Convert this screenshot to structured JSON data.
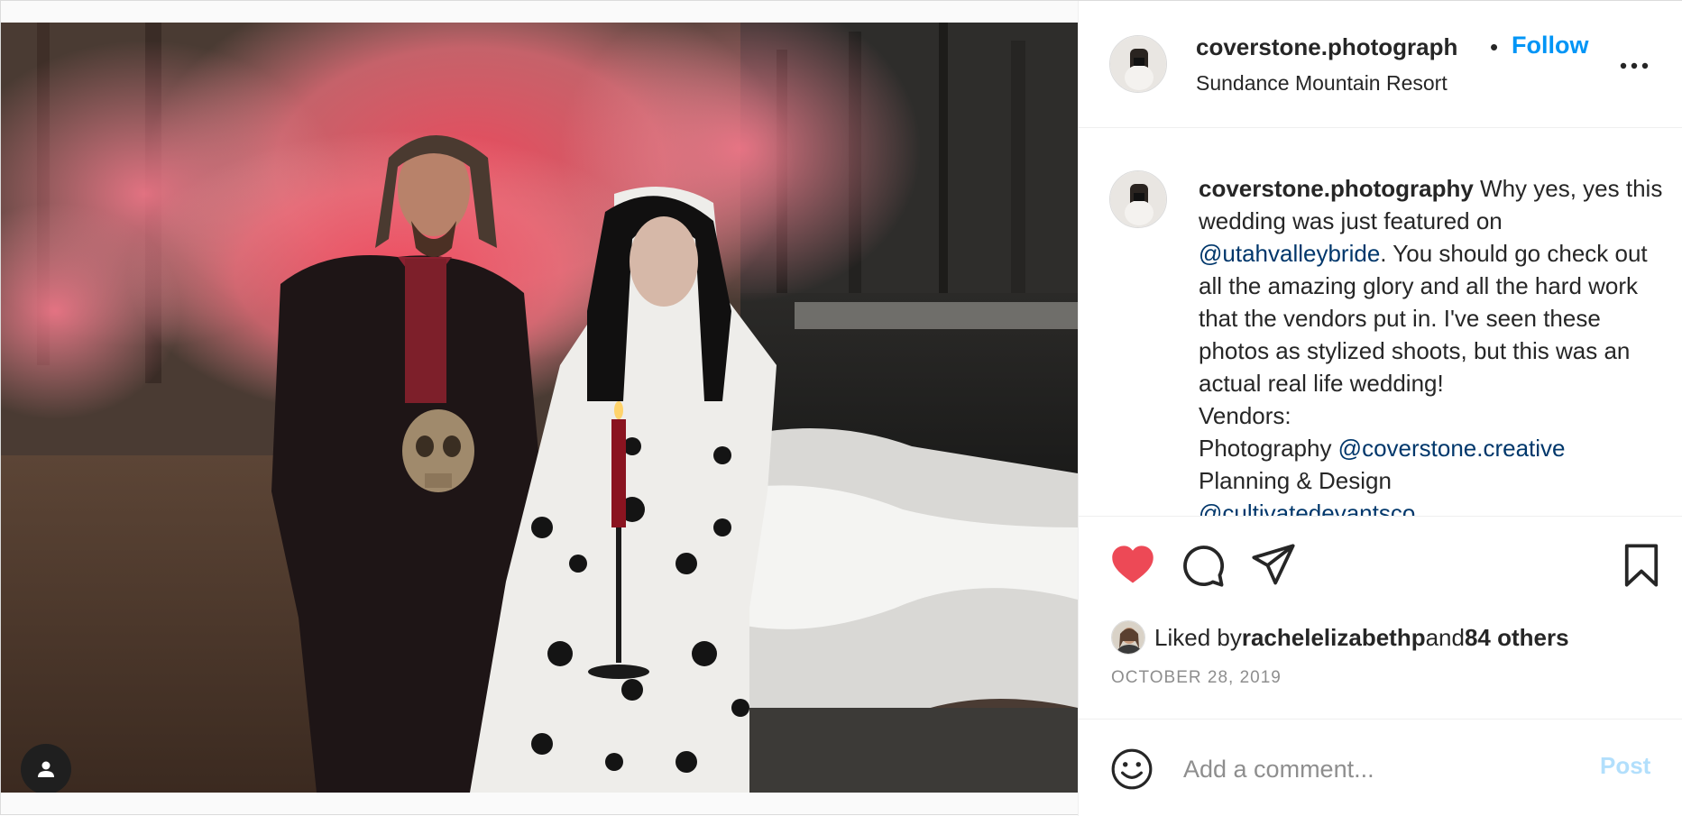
{
  "post": {
    "username": "coverstone.photograph",
    "dot": "•",
    "follow_label": "Follow",
    "location": "Sundance Mountain Resort",
    "more_icon": "more-horizontal-icon"
  },
  "caption": {
    "username": "coverstone.photography",
    "text_1": " Why yes, yes this wedding was just featured on ",
    "mention_1": "@utahvalleybride",
    "text_2": ". You should go check out all the amazing glory and all the hard work that the vendors put in. I've seen these photos as stylized shoots, but this was an actual real life wedding!",
    "vendors_label": "Vendors:",
    "photography_label": "Photography ",
    "mention_2": "@coverstone.creative",
    "planning_label": "Planning & Design",
    "mention_3": "@cultivatedevantsco"
  },
  "actions": {
    "like_icon": "heart-filled-icon",
    "comment_icon": "comment-icon",
    "share_icon": "share-icon",
    "save_icon": "bookmark-icon",
    "like_color": "#ed4956"
  },
  "likes": {
    "prefix": "Liked by ",
    "user": "rachelelizabethp",
    "middle": " and ",
    "others": "84 others"
  },
  "date": "OCTOBER 28, 2019",
  "comment": {
    "placeholder": "Add a comment...",
    "post_label": "Post",
    "emoji_icon": "emoji-icon"
  },
  "colors": {
    "accent": "#0095f6",
    "mention": "#00376b",
    "post_disabled": "#b2dffc",
    "muted": "#8e8e8e"
  }
}
